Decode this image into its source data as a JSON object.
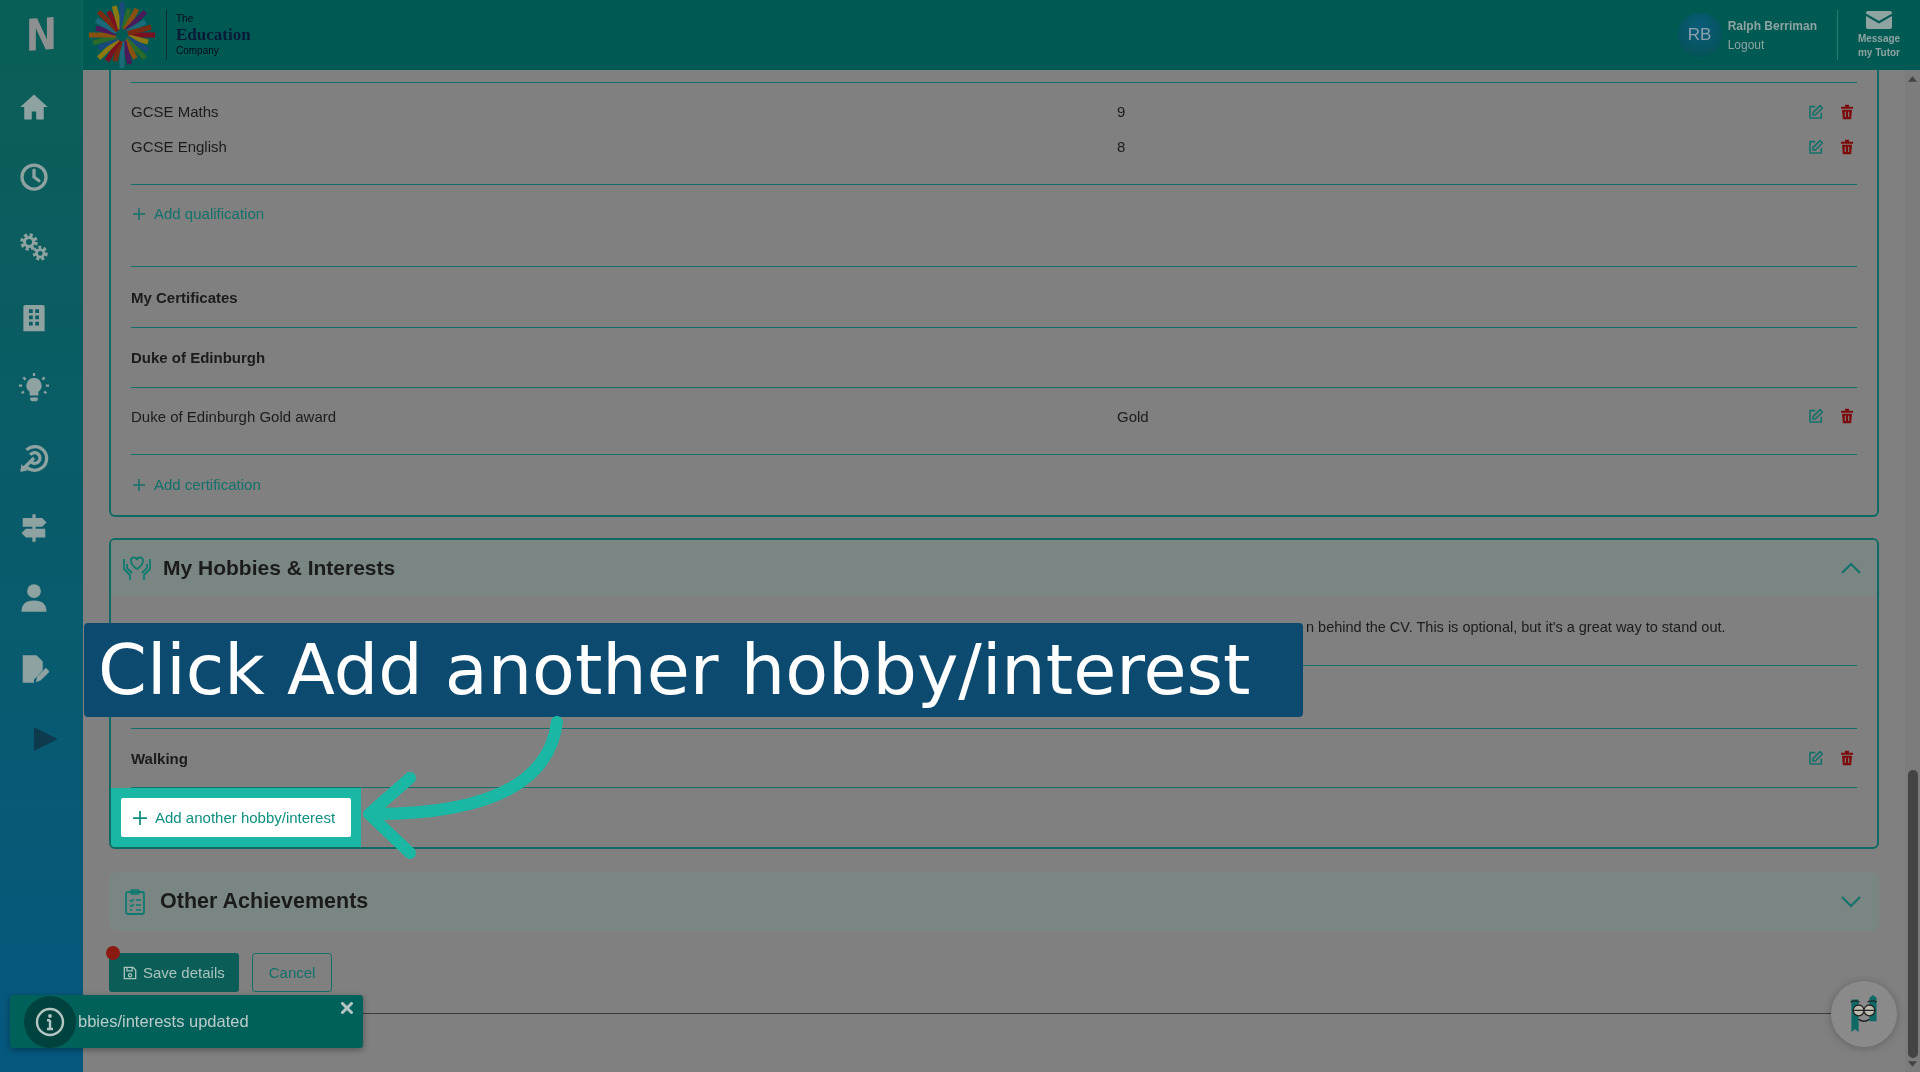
{
  "header": {
    "app_logo": "N",
    "brand": {
      "line_1": "The",
      "line_2": "Education",
      "line_3": "Company"
    },
    "user": {
      "initials": "RB",
      "name": "Ralph Berriman",
      "logout": "Logout"
    },
    "message_button": "Message my Tutor"
  },
  "qualifications": {
    "rows": [
      {
        "name": "GCSE Maths",
        "grade": "9"
      },
      {
        "name": "GCSE English",
        "grade": "8"
      }
    ],
    "add_link": "Add qualification"
  },
  "certificates": {
    "title": "My Certificates",
    "groups": [
      {
        "title": "Duke of Edinburgh",
        "rows": [
          {
            "name": "Duke of Edinburgh Gold award",
            "award": "Gold"
          }
        ]
      }
    ],
    "add_link": "Add certification"
  },
  "hobbies": {
    "title": "My Hobbies & Interests",
    "expanded": true,
    "intro": "n behind the CV. This is optional, but it's a great way to stand out.",
    "items": [
      {
        "name": "Walking"
      }
    ],
    "add_button": "Add another hobby/interest",
    "add_button_highlighted": true
  },
  "other_achievements": {
    "title": "Other Achievements",
    "expanded": false
  },
  "actions": {
    "save": "Save details",
    "cancel": "Cancel",
    "unsaved_changes": true
  },
  "toast": {
    "message": "bbies/interests updated"
  },
  "tour": {
    "callout": "Click Add another hobby/interest"
  }
}
